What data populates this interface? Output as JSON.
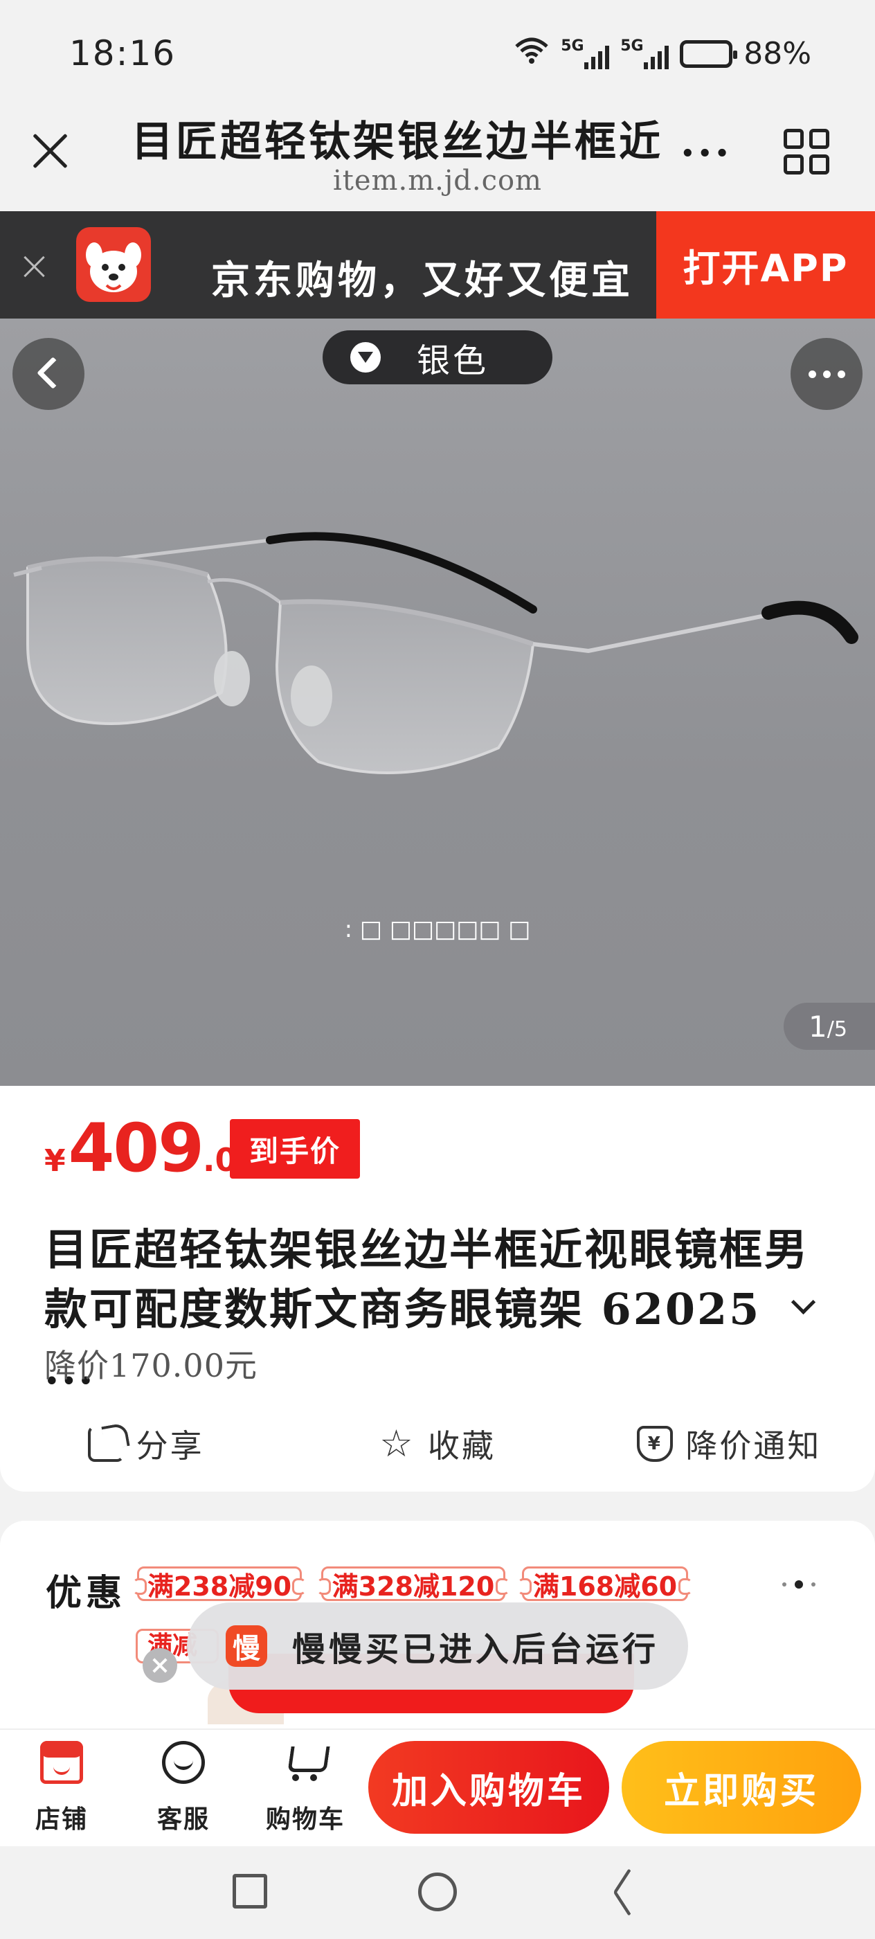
{
  "status_bar": {
    "time": "18:16",
    "network_1": "5G",
    "network_2": "5G",
    "battery_level": 0.88,
    "battery_text": "88%"
  },
  "header": {
    "title": "目匠超轻钛架银丝边半框近 ...",
    "url": "item.m.jd.com"
  },
  "app_banner": {
    "slogan": "京东购物，又好又便宜",
    "open_button": "打开APP",
    "accent": "#f3371e"
  },
  "gallery": {
    "color_selector": "银色",
    "caption": ": □ □□□□□ □",
    "counter_current": "1",
    "counter_total": "/5"
  },
  "product": {
    "currency": "¥",
    "price_int": "409",
    "price_dec": ".00",
    "price_tag": "到手价",
    "title": "目匠超轻钛架银丝边半框近视眼镜框男款可配度数斯文商务眼镜架 62025  ...",
    "price_drop": "降价170.00元",
    "actions": [
      {
        "label": "分享"
      },
      {
        "label": "收藏"
      },
      {
        "label": "降价通知"
      }
    ],
    "price_color": "#e8231f"
  },
  "promo": {
    "label": "优惠",
    "coupons": [
      "满238减90",
      "满328减120",
      "满168减60"
    ],
    "coupon_partial": "满减"
  },
  "toast": {
    "app_glyph": "慢",
    "message": "慢慢买已进入后台运行"
  },
  "bottom_bar": {
    "tabs": [
      {
        "label": "店铺"
      },
      {
        "label": "客服"
      },
      {
        "label": "购物车"
      }
    ],
    "add_to_cart": "加入购物车",
    "buy_now": "立即购买"
  }
}
